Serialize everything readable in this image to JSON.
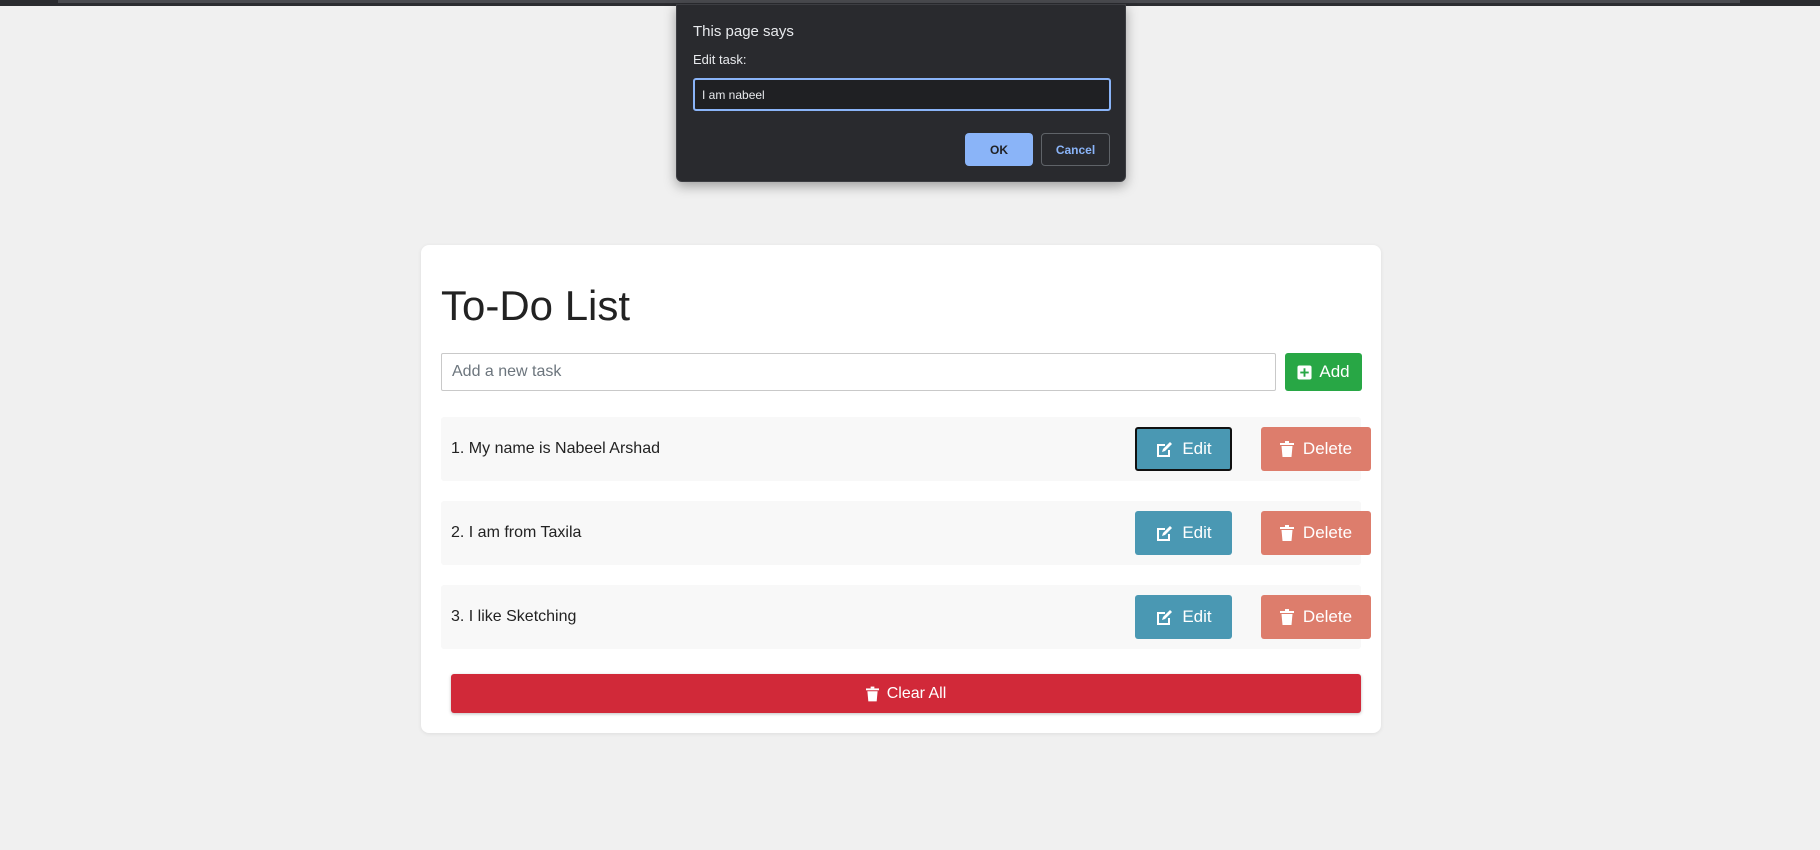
{
  "dialog": {
    "title": "This page says",
    "message": "Edit task:",
    "input_value": "I am nabeel",
    "ok_label": "OK",
    "cancel_label": "Cancel"
  },
  "todo": {
    "title": "To-Do List",
    "input_placeholder": "Add a new task",
    "add_label": "Add",
    "tasks": [
      {
        "text": "1. My name is Nabeel Arshad",
        "edit_label": "Edit",
        "delete_label": "Delete"
      },
      {
        "text": "2. I am from Taxila",
        "edit_label": "Edit",
        "delete_label": "Delete"
      },
      {
        "text": "3. I like Sketching",
        "edit_label": "Edit",
        "delete_label": "Delete"
      }
    ],
    "clear_all_label": "Clear All"
  },
  "colors": {
    "page_bg": "#f0f0f0",
    "add": "#28a745",
    "edit": "#4a98b3",
    "delete": "#dd7d6c",
    "clear_all": "#d12939",
    "dialog_accent": "#8ab4f8"
  },
  "icons": {
    "add": "plus-square-icon",
    "edit": "edit-icon",
    "delete": "trash-icon",
    "clear_all": "trash-icon"
  }
}
